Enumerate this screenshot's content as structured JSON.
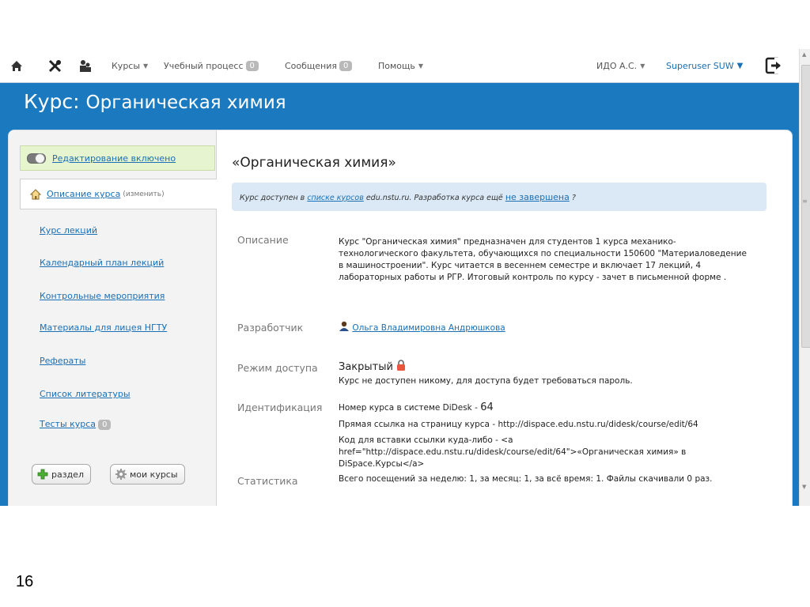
{
  "topbar": {
    "courses": "Курсы",
    "process": "Учебный процесс",
    "process_badge": "0",
    "messages": "Сообщения",
    "messages_badge": "0",
    "help": "Помощь",
    "org": "ИДО А.С.",
    "user": "Superuser SUW",
    "icons": [
      "home-icon",
      "tools-icon",
      "users-icon",
      "exit-icon"
    ]
  },
  "page": {
    "title_prefix": "Курс:",
    "title_name": "Органическая химия"
  },
  "sidebar": {
    "edit_toggle": "Редактирование включено",
    "desc_tab": "Описание курса",
    "desc_tab_edit": "(изменить)",
    "items": [
      {
        "label": "Курс лекций"
      },
      {
        "label": "Календарный план лекций"
      },
      {
        "label": "Контрольные мероприятия"
      },
      {
        "label": "Материалы для лицея НГТУ"
      },
      {
        "label": "Рефераты"
      },
      {
        "label": "Список литературы"
      },
      {
        "label": "Тесты курса",
        "badge": "0"
      }
    ],
    "add_section_button": "раздел",
    "my_courses_button": "мои курсы"
  },
  "main": {
    "title": "«Органическая химия»",
    "notice": {
      "text1": "Курс доступен в",
      "link1": "списке курсов",
      "text2": "edu.nstu.ru. Разработка курса ещё",
      "link2": "не завершена",
      "text3": "?"
    },
    "fields": {
      "description_label": "Описание",
      "description_value": "Курс \"Органическая химия\" предназначен для студентов 1 курса механико-технологического факультета, обучающихся по специальности 150600 \"Материаловедение в машиностроении\". Курс читается в весеннем семестре и включает 17 лекций, 4 лабораторных работы и РГР. Итоговый контроль по курсу - зачет в письменной форме .",
      "developer_label": "Разработчик",
      "developer_value": "Ольга Владимировна Андрюшкова",
      "access_label": "Режим доступа",
      "access_value": "Закрытый",
      "access_note": "Курс не доступен никому, для доступа будет требоваться пароль.",
      "ident_label": "Идентификация",
      "ident_line1_text": "Номер курса в системе DiDesk -",
      "ident_line1_num": "64",
      "ident_line2": "Прямая ссылка на страницу курса - http://dispace.edu.nstu.ru/didesk/course/edit/64",
      "ident_line3": "Код для вставки ссылки куда-либо - <a href=\"http://dispace.edu.nstu.ru/didesk/course/edit/64\">«Органическая химия» в DiSpace.Курсы</a>",
      "stats_label": "Статистика",
      "stats_value": "Всего посещений за неделю: 1, за месяц: 1, за всё время: 1. Файлы скачивали 0 раз."
    }
  },
  "slide_number": "16",
  "colors": {
    "accent": "#1a79bf",
    "link": "#1a6fb5",
    "edit_bg": "#e6f5cf",
    "notice_bg": "#dbe9f6"
  }
}
